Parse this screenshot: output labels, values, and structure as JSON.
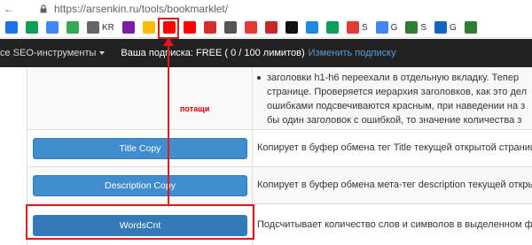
{
  "browser": {
    "url": "https://arsenkin.ru/tools/bookmarklet/"
  },
  "bookmarks": [
    {
      "icon": "bookmark-icon",
      "label": "",
      "color": "#1a73e8"
    },
    {
      "icon": "drive-icon",
      "label": "",
      "color": "#0f9d58"
    },
    {
      "icon": "clipboard-icon",
      "label": "",
      "color": "#4285f4"
    },
    {
      "icon": "chart-icon",
      "label": "",
      "color": "#34a853"
    },
    {
      "icon": "kr-icon",
      "label": "KR",
      "color": "#666666"
    },
    {
      "icon": "code-icon",
      "label": "",
      "color": "#7b1fa2"
    },
    {
      "icon": "bars-icon",
      "label": "",
      "color": "#fbbc05"
    },
    {
      "icon": "youtube-icon",
      "label": "",
      "color": "#ff0000"
    },
    {
      "icon": "youtube-icon",
      "label": "",
      "color": "#ff0000"
    },
    {
      "icon": "red-square-icon",
      "label": "",
      "color": "#d32f2f"
    },
    {
      "icon": "text-icon",
      "label": "",
      "color": "#555555"
    },
    {
      "icon": "slide-icon",
      "label": "",
      "color": "#e53935"
    },
    {
      "icon": "t-icon",
      "label": "",
      "color": "#c62828"
    },
    {
      "icon": "a-icon",
      "label": "",
      "color": "#111111"
    },
    {
      "icon": "doc-icon",
      "label": "",
      "color": "#1e88e5"
    },
    {
      "icon": "drive2-icon",
      "label": "",
      "color": "#0f9d58"
    },
    {
      "icon": "s-icon",
      "label": "S",
      "color": "#e53935"
    },
    {
      "icon": "g-icon",
      "label": "G",
      "color": "#4285f4"
    },
    {
      "icon": "t-green-icon",
      "label": "S",
      "color": "#2e7d32"
    },
    {
      "icon": "cube-icon",
      "label": "G",
      "color": "#1565c0"
    },
    {
      "icon": "t-green-icon",
      "label": "",
      "color": "#2e7d32"
    }
  ],
  "nav": {
    "menu_label": "се SEO-инструменты",
    "subscription_text": "Ваша подписка: FREE ( 0 / 100 лимитов)",
    "subscription_link": "Изменить подписку"
  },
  "rows": {
    "headings": {
      "lines": [
        "заголовки h1-h6 переехали в отдельную вкладку. Тепер",
        "странице. Проверяется иерархия заголовков, как это дел",
        "ошибками подсвечиваются красным, при наведении на з",
        "бы один заголовок с ошибкой, то значение количества з"
      ],
      "annotation": "потащи"
    },
    "title_copy": {
      "button": "Title Copy",
      "description": "Копирует в буфер обмена тег Title текущей открытой страниц"
    },
    "description_copy": {
      "button": "Description Copy",
      "description": "Копирует в буфер обмена мета-тег description текущей открыт"
    },
    "wordscnt": {
      "button": "WordsCnt",
      "description": "Подсчитывает количество слов и символов в выделенном фр"
    }
  },
  "colors": {
    "button_blue": "#3f8dce",
    "highlight_red": "#e0191e",
    "nav_dark": "#222222"
  }
}
